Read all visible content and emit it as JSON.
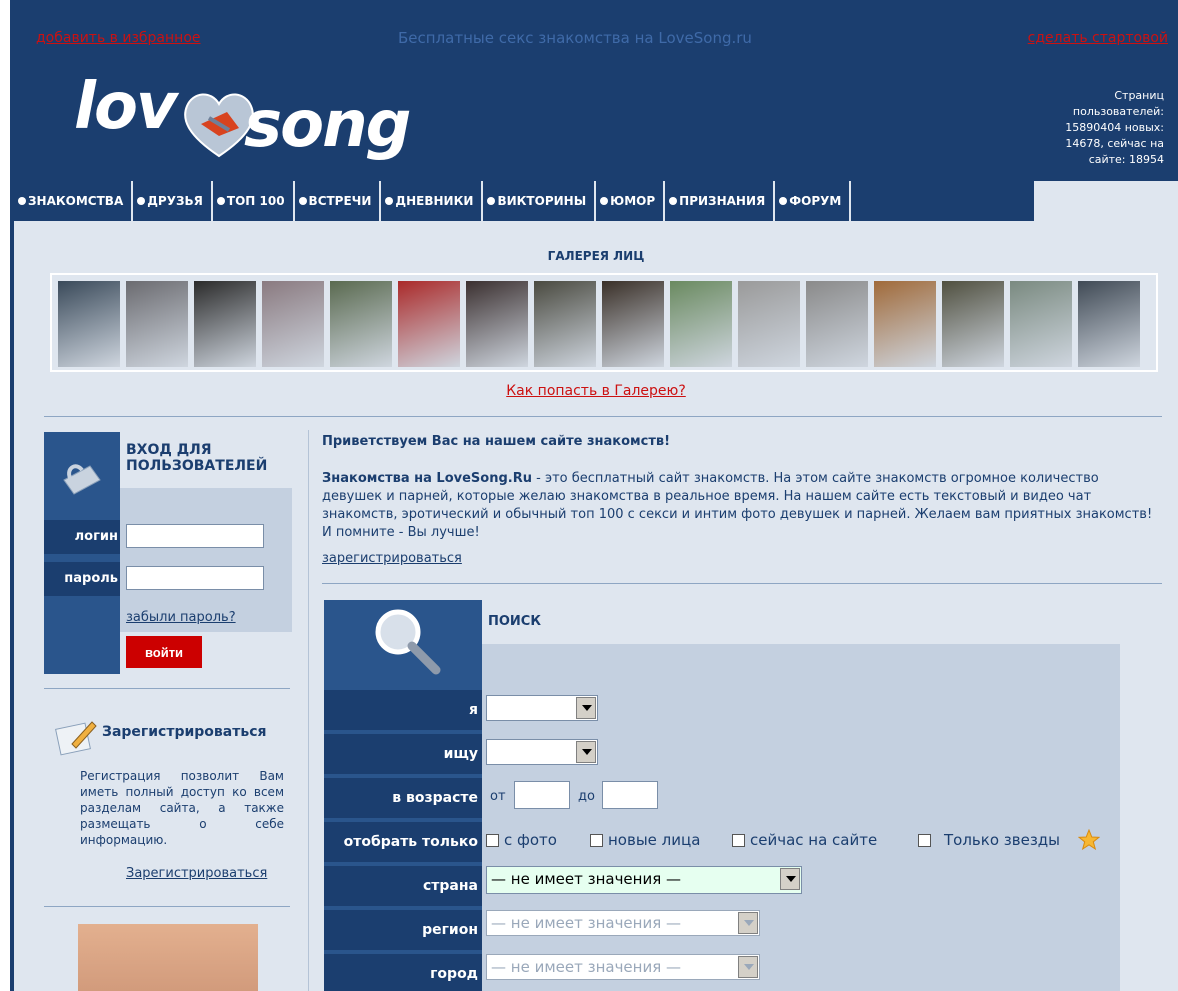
{
  "header": {
    "add_favorites": "добавить в избранное",
    "site_title": "Бесплатные секс знакомства на LoveSong.ru",
    "make_homepage": "сделать стартовой",
    "logo_text_left": "lov",
    "logo_text_right": "song",
    "stats": "Страниц пользователей: 15890404 новых: 14678, сейчас на сайте: 18954"
  },
  "nav": [
    {
      "label": "ЗНАКОМСТВА"
    },
    {
      "label": "ДРУЗЬЯ"
    },
    {
      "label": "ТОП 100"
    },
    {
      "label": "ВСТРЕЧИ"
    },
    {
      "label": "ДНЕВНИКИ"
    },
    {
      "label": "ВИКТОРИНЫ"
    },
    {
      "label": "ЮМОР"
    },
    {
      "label": "ПРИЗНАНИЯ"
    },
    {
      "label": "ФОРУМ"
    }
  ],
  "gallery": {
    "title": "ГАЛЕРЕЯ ЛИЦ",
    "link": "Как попасть в Галерею?",
    "thumb_colors": [
      "#3a4a5a",
      "#6b6b70",
      "#2b2b2b",
      "#8a7a80",
      "#5a6a50",
      "#aa2a2a",
      "#3b3030",
      "#4a4a40",
      "#3a3028",
      "#6a8a60",
      "#9a9a9a",
      "#8a8a8a",
      "#a06a3a",
      "#505040",
      "#7a8a80",
      "#404a55"
    ]
  },
  "login": {
    "title": "ВХОД ДЛЯ ПОЛЬЗОВАТЕЛЕЙ",
    "login_label": "логин",
    "password_label": "пароль",
    "forgot": "забыли пароль?",
    "button": "войти"
  },
  "register": {
    "title": "Зарегистрироваться",
    "text": "Регистрация позволит Вам иметь полный доступ ко всем разделам сайта, а также размещать о себе информацию.",
    "link": "Зарегистрироваться"
  },
  "welcome": {
    "title": "Приветствуем Вас на нашем сайте знакомств!",
    "brand": "Знакомства на LoveSong.Ru",
    "text": " - это бесплатный сайт знакомств. На этом сайте знакомств огромное количество девушек и парней, которые желаю знакомства в реальное время. На нашем сайте есть текстовый и видео чат знакомств, эротический и обычный топ 100 с секси и интим фото девушек и парней. Желаем вам приятных знакомств! И помните - Вы лучше!",
    "register_link": "зарегистрироваться"
  },
  "search": {
    "title": "ПОИСК",
    "i_label": "я",
    "seek_label": "ищу",
    "age_label": "в возрасте",
    "age_from": "от",
    "age_to": "до",
    "filter_label": "отобрать только",
    "with_photo": "с фото",
    "new_faces": "новые лица",
    "online": "сейчас на сайте",
    "stars_only": "Только звезды",
    "country_label": "страна",
    "country_value": "— не имеет значения —",
    "region_label": "регион",
    "region_value": "— не имеет значения —",
    "city_label": "город",
    "city_value": "— не имеет значения —"
  }
}
